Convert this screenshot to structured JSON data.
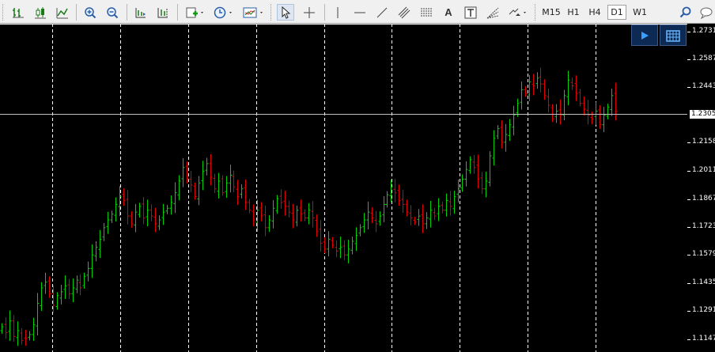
{
  "toolbar": {
    "timeframes": [
      "M15",
      "H1",
      "H4",
      "D1",
      "W1"
    ],
    "active_timeframe": "D1",
    "text_tool_label": "A",
    "icons": [
      "bar-chart-icon",
      "candlestick-icon",
      "line-chart-icon",
      "zoom-in-icon",
      "zoom-out-icon",
      "autoscroll-icon",
      "chart-shift-icon",
      "new-order-icon",
      "periods-icon",
      "templates-icon",
      "cursor-icon",
      "crosshair-icon",
      "vertical-line-icon",
      "horizontal-line-icon",
      "trendline-icon",
      "equidistant-channel-icon",
      "fibonacci-icon",
      "text-icon",
      "text-label-icon",
      "fibonacci-fan-icon",
      "arrows-icon",
      "search-icon",
      "chat-icon"
    ]
  },
  "floating_buttons": {
    "play_icon": "play-icon",
    "calendar_icon": "calendar-icon"
  },
  "colors": {
    "background": "#000000",
    "bull": "#00d000",
    "bear": "#e00000",
    "grid": "#ffffff",
    "current_price_line": "#c0c0c0"
  },
  "price_axis": {
    "labels": [
      "1.2731",
      "1.2587",
      "1.2443",
      "1.2158",
      "1.2011",
      "1.1867",
      "1.1723",
      "1.1579",
      "1.1435",
      "1.1291",
      "1.1147"
    ],
    "current_price": "1.2305"
  },
  "chart_data": {
    "type": "candlestick",
    "symbol_timeframe": "D1",
    "ylim": [
      1.108,
      1.277
    ],
    "x_count": 157,
    "period_separators": 9,
    "closes": [
      1.121,
      1.118,
      1.124,
      1.116,
      1.119,
      1.114,
      1.115,
      1.117,
      1.122,
      1.133,
      1.141,
      1.144,
      1.138,
      1.132,
      1.137,
      1.139,
      1.142,
      1.138,
      1.141,
      1.145,
      1.141,
      1.147,
      1.151,
      1.158,
      1.162,
      1.166,
      1.172,
      1.176,
      1.179,
      1.184,
      1.188,
      1.186,
      1.178,
      1.174,
      1.18,
      1.183,
      1.177,
      1.181,
      1.178,
      1.174,
      1.176,
      1.18,
      1.182,
      1.185,
      1.19,
      1.196,
      1.203,
      1.197,
      1.194,
      1.188,
      1.195,
      1.201,
      1.205,
      1.198,
      1.192,
      1.196,
      1.19,
      1.195,
      1.199,
      1.193,
      1.188,
      1.192,
      1.185,
      1.181,
      1.176,
      1.181,
      1.178,
      1.172,
      1.176,
      1.182,
      1.187,
      1.185,
      1.183,
      1.18,
      1.176,
      1.181,
      1.179,
      1.177,
      1.181,
      1.177,
      1.17,
      1.164,
      1.161,
      1.166,
      1.163,
      1.16,
      1.162,
      1.158,
      1.161,
      1.165,
      1.168,
      1.172,
      1.176,
      1.18,
      1.177,
      1.174,
      1.178,
      1.184,
      1.189,
      1.193,
      1.19,
      1.186,
      1.184,
      1.18,
      1.177,
      1.175,
      1.178,
      1.174,
      1.177,
      1.181,
      1.178,
      1.183,
      1.181,
      1.186,
      1.183,
      1.188,
      1.192,
      1.197,
      1.202,
      1.207,
      1.203,
      1.197,
      1.192,
      1.196,
      1.209,
      1.218,
      1.223,
      1.216,
      1.22,
      1.225,
      1.23,
      1.236,
      1.243,
      1.241,
      1.247,
      1.245,
      1.249,
      1.246,
      1.24,
      1.235,
      1.228,
      1.232,
      1.23,
      1.24,
      1.248,
      1.245,
      1.241,
      1.236,
      1.233,
      1.23,
      1.228,
      1.232,
      1.225,
      1.23,
      1.234,
      1.24,
      1.232
    ]
  }
}
